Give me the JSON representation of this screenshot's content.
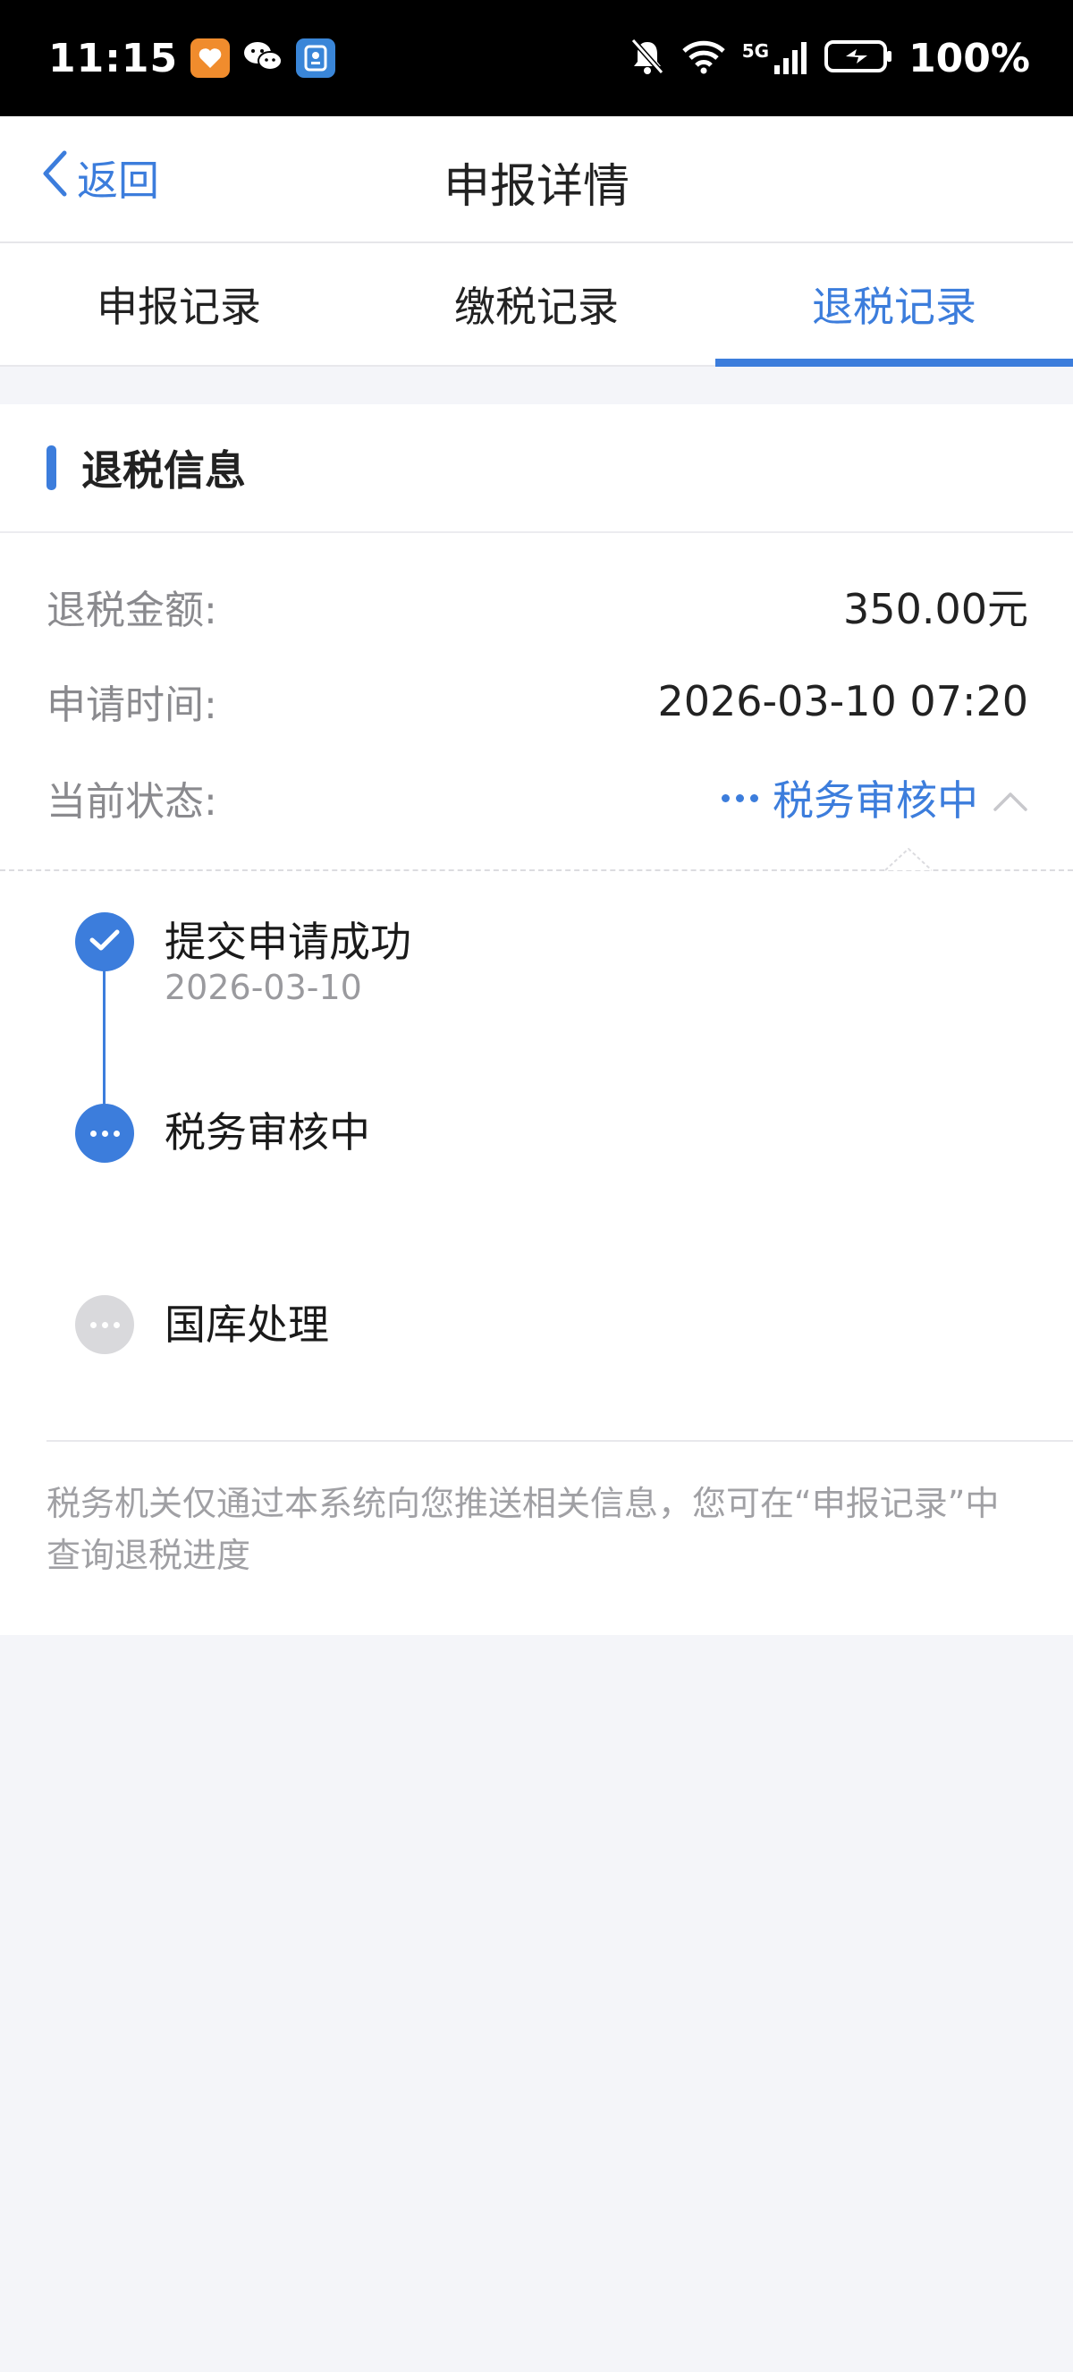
{
  "status_bar": {
    "time": "11:15",
    "battery": "100%",
    "network": "5G"
  },
  "nav": {
    "back_label": "返回",
    "title": "申报详情"
  },
  "tabs": [
    {
      "label": "申报记录",
      "active": false
    },
    {
      "label": "缴税记录",
      "active": false
    },
    {
      "label": "退税记录",
      "active": true
    }
  ],
  "card": {
    "title": "退税信息",
    "rows": {
      "amount_label": "退税金额:",
      "amount_value": "350.00元",
      "time_label": "申请时间:",
      "time_value": "2026-03-10 07:20",
      "status_label": "当前状态:",
      "status_value": "税务审核中"
    },
    "timeline": [
      {
        "title": "提交申请成功",
        "date": "2026-03-10",
        "state": "done"
      },
      {
        "title": "税务审核中",
        "date": "",
        "state": "current"
      },
      {
        "title": "国库处理",
        "date": "",
        "state": "pending"
      }
    ],
    "note": "税务机关仅通过本系统向您推送相关信息，您可在“申报记录”中查询退税进度"
  },
  "colors": {
    "accent": "#3c7ddc",
    "pending": "#d9d9dc"
  }
}
